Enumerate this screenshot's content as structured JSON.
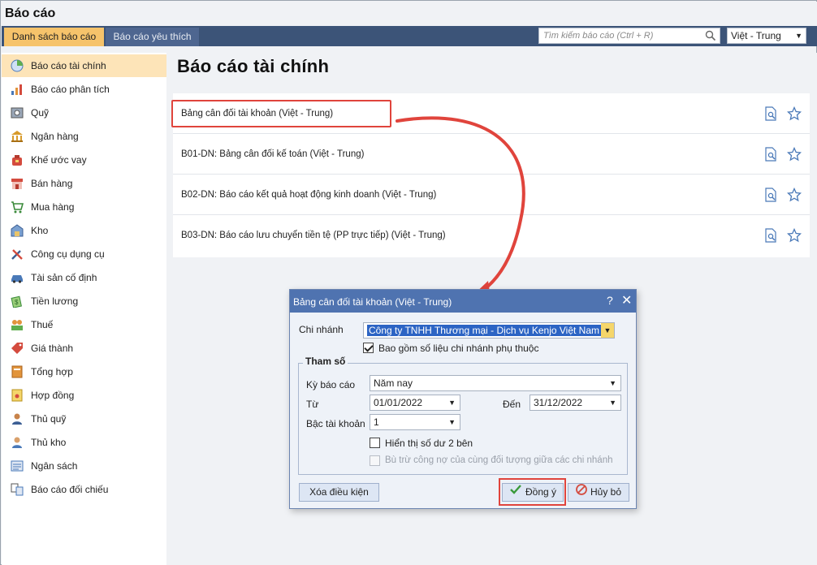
{
  "app": {
    "title": "Báo cáo"
  },
  "tabs": [
    {
      "label": "Danh sách báo cáo",
      "active": true
    },
    {
      "label": "Báo cáo yêu thích",
      "active": false
    }
  ],
  "search": {
    "placeholder": "Tìm kiếm báo cáo (Ctrl + R)"
  },
  "language": {
    "selected": "Việt - Trung"
  },
  "sidebar": {
    "items": [
      {
        "label": "Báo cáo tài chính",
        "icon": "pie-chart-icon",
        "active": true
      },
      {
        "label": "Báo cáo phân tích",
        "icon": "bar-chart-icon"
      },
      {
        "label": "Quỹ",
        "icon": "safe-icon"
      },
      {
        "label": "Ngân hàng",
        "icon": "bank-icon"
      },
      {
        "label": "Khế ước vay",
        "icon": "loan-bag-icon"
      },
      {
        "label": "Bán hàng",
        "icon": "store-icon"
      },
      {
        "label": "Mua hàng",
        "icon": "cart-icon"
      },
      {
        "label": "Kho",
        "icon": "warehouse-icon"
      },
      {
        "label": "Công cụ dụng cụ",
        "icon": "tools-icon"
      },
      {
        "label": "Tài sản cố định",
        "icon": "car-icon"
      },
      {
        "label": "Tiền lương",
        "icon": "money-icon"
      },
      {
        "label": "Thuế",
        "icon": "tax-icon"
      },
      {
        "label": "Giá thành",
        "icon": "price-tag-icon"
      },
      {
        "label": "Tổng hợp",
        "icon": "book-icon"
      },
      {
        "label": "Hợp đồng",
        "icon": "contract-icon"
      },
      {
        "label": "Thủ quỹ",
        "icon": "cashier-icon"
      },
      {
        "label": "Thủ kho",
        "icon": "storekeeper-icon"
      },
      {
        "label": "Ngân sách",
        "icon": "budget-icon"
      },
      {
        "label": "Báo cáo đối chiếu",
        "icon": "compare-icon"
      }
    ]
  },
  "main": {
    "title": "Báo cáo tài chính",
    "reports": [
      {
        "name": "Bảng cân đối tài khoản (Việt - Trung)"
      },
      {
        "name": "B01-DN: Bảng cân đối kế toán (Việt - Trung)"
      },
      {
        "name": "B02-DN: Báo cáo kết quả hoạt động kinh doanh (Việt - Trung)"
      },
      {
        "name": "B03-DN: Báo cáo lưu chuyển tiền tệ (PP trực tiếp) (Việt - Trung)"
      }
    ]
  },
  "dialog": {
    "title": "Bảng cân đối tài khoản (Việt - Trung)",
    "help": "?",
    "close": "✕",
    "branch_label": "Chi nhánh",
    "branch_value": "Công ty TNHH Thương mại - Dịch vụ Kenjo Việt Nam",
    "include_dependent_label": "Bao gồm số liệu chi nhánh phụ thuộc",
    "include_dependent_checked": true,
    "params_title": "Tham số",
    "period_label": "Kỳ báo cáo",
    "period_value": "Năm nay",
    "from_label": "Từ",
    "from_value": "01/01/2022",
    "to_label": "Đến",
    "to_value": "31/12/2022",
    "account_level_label": "Bậc tài khoản",
    "account_level_value": "1",
    "show_dual_balance_label": "Hiển thị số dư 2 bên",
    "show_dual_balance_checked": false,
    "offset_label": "Bù trừ công nợ của cùng đối tượng giữa các chi nhánh",
    "offset_enabled": false,
    "clear_button": "Xóa điều kiện",
    "ok_button": "Đồng ý",
    "cancel_button": "Hủy bỏ"
  },
  "colors": {
    "tabbar": "#3c5478",
    "active_tab": "#f6c36b",
    "sidebar_active": "#fde4b8",
    "dialog_header": "#4f73b0",
    "highlight": "#e0443c"
  }
}
